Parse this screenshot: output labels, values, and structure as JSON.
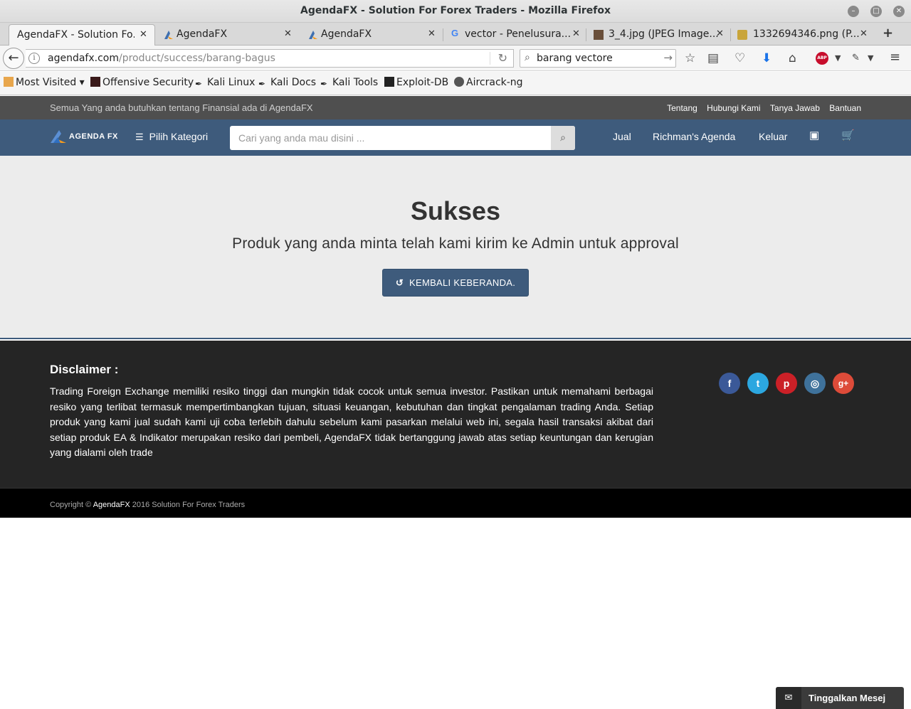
{
  "window": {
    "title": "AgendaFX - Solution For Forex Traders - Mozilla Firefox"
  },
  "tabs": [
    {
      "label": "AgendaFX - Solution Fo...",
      "icon": "close"
    },
    {
      "label": "AgendaFX",
      "icon": "agendafx-logo-icon"
    },
    {
      "label": "AgendaFX",
      "icon": "agendafx-logo-icon"
    },
    {
      "label": "vector - Penelusura...",
      "icon": "google-icon"
    },
    {
      "label": "3_4.jpg (JPEG Image...",
      "icon": "image-thumb-icon"
    },
    {
      "label": "1332694346.png (P...",
      "icon": "image-thumb-icon"
    }
  ],
  "navbar": {
    "url_host": "agendafx.com",
    "url_path": "/product/success/barang-bagus",
    "search_value": "barang vectore"
  },
  "bookmarks": [
    {
      "label": "Most Visited ▾",
      "icon": "folder-icon"
    },
    {
      "label": "Offensive Security",
      "icon": "offsec-icon"
    },
    {
      "label": "Kali Linux",
      "icon": "kali-icon"
    },
    {
      "label": "Kali Docs",
      "icon": "kali-icon"
    },
    {
      "label": "Kali Tools",
      "icon": "kali-icon"
    },
    {
      "label": "Exploit-DB",
      "icon": "exploitdb-icon"
    },
    {
      "label": "Aircrack-ng",
      "icon": "aircrack-icon"
    }
  ],
  "site": {
    "tagline": "Semua Yang anda butuhkan tentang Finansial ada di AgendaFX",
    "top_links": [
      "Tentang",
      "Hubungi Kami",
      "Tanya Jawab",
      "Bantuan"
    ],
    "logo_text": "AGENDA FX",
    "category_label": "Pilih Kategori",
    "search_placeholder": "Cari yang anda mau disini ...",
    "nav_links": [
      "Jual",
      "Richman's Agenda",
      "Keluar"
    ]
  },
  "main": {
    "heading": "Sukses",
    "message": "Produk yang anda minta telah kami kirim ke Admin untuk approval",
    "button_label": "KEMBALI KEBERANDA."
  },
  "footer": {
    "disclaimer_title": "Disclaimer :",
    "disclaimer_text": "Trading Foreign Exchange memiliki resiko tinggi dan mungkin tidak cocok untuk semua investor. Pastikan untuk memahami berbagai resiko yang terlibat termasuk mempertimbangkan tujuan, situasi keuangan, kebutuhan dan tingkat pengalaman trading Anda. Setiap produk yang kami jual sudah kami uji coba terlebih dahulu sebelum kami pasarkan melalui web ini, segala hasil transaksi akibat dari setiap produk EA & Indikator merupakan resiko dari pembeli, AgendaFX tidak bertanggung jawab atas setiap keuntungan dan kerugian yang dialami oleh trade",
    "social": [
      {
        "name": "facebook",
        "glyph": "f",
        "color": "#3b5998"
      },
      {
        "name": "twitter",
        "glyph": "t",
        "color": "#2ca7e0"
      },
      {
        "name": "pinterest",
        "glyph": "p",
        "color": "#cb2027"
      },
      {
        "name": "instagram",
        "glyph": "◎",
        "color": "#3f729b"
      },
      {
        "name": "google-plus",
        "glyph": "g+",
        "color": "#dd4b39"
      }
    ],
    "copyright_prefix": "Copyright ©",
    "copyright_brand": "AgendaFX",
    "copyright_suffix": "2016 Solution For Forex Traders"
  },
  "chat_widget": {
    "label": "Tinggalkan Mesej"
  },
  "colors": {
    "brand": "#3e5b7c",
    "footer_bg": "#252525",
    "content_bg": "#ececec"
  }
}
